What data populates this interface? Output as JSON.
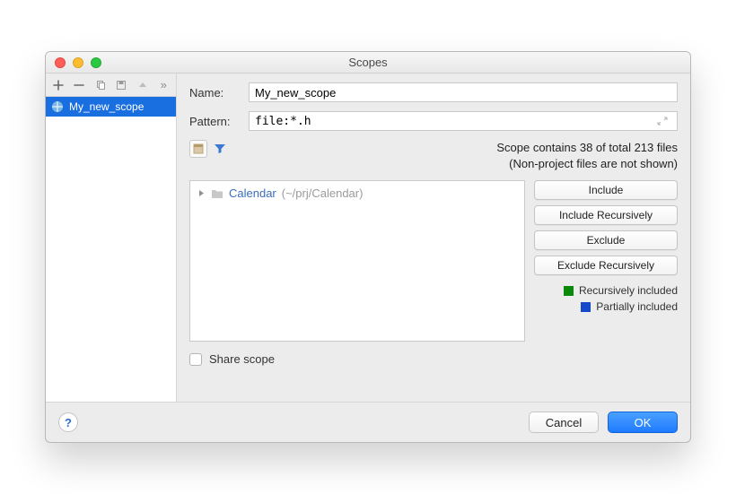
{
  "window": {
    "title": "Scopes"
  },
  "left_toolbar": {
    "add": "+",
    "remove": "−",
    "copy": "copy",
    "save": "save",
    "up": "▲",
    "more": "»"
  },
  "scopes": [
    {
      "name": "My_new_scope",
      "selected": true
    }
  ],
  "fields": {
    "name_label": "Name:",
    "name_value": "My_new_scope",
    "pattern_label": "Pattern:",
    "pattern_value": "file:*.h"
  },
  "stats": {
    "line1": "Scope contains 38 of total 213 files",
    "line2": "(Non-project files are not shown)"
  },
  "tree": [
    {
      "name": "Calendar",
      "path": "(~/prj/Calendar)"
    }
  ],
  "buttons": {
    "include": "Include",
    "include_recursively": "Include Recursively",
    "exclude": "Exclude",
    "exclude_recursively": "Exclude Recursively"
  },
  "legend": {
    "recursively": "Recursively included",
    "partially": "Partially included",
    "colors": {
      "recursively": "#0a8a0a",
      "partially": "#1549c9"
    }
  },
  "share": {
    "label": "Share scope",
    "checked": false
  },
  "footer": {
    "help": "?",
    "cancel": "Cancel",
    "ok": "OK"
  }
}
